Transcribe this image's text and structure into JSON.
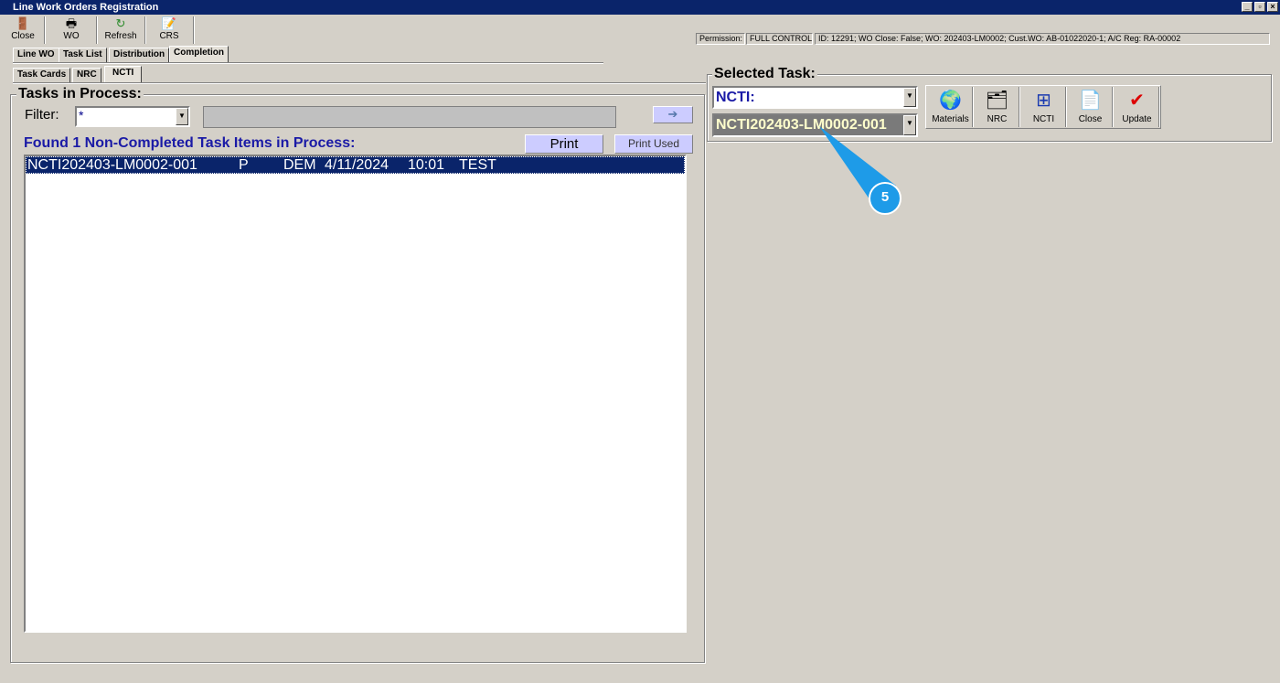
{
  "window": {
    "title": "Line Work Orders Registration"
  },
  "toolbar": {
    "items": [
      {
        "label": "Close",
        "icon": "exit-door-icon"
      },
      {
        "label": "WO",
        "icon": "printer-icon"
      },
      {
        "label": "Refresh",
        "icon": "refresh-icon"
      },
      {
        "label": "CRS",
        "icon": "certificate-icon"
      }
    ]
  },
  "status": {
    "permission_label": "Permission:",
    "permission_value": "FULL CONTROL",
    "info": "ID: 12291; WO Close: False; WO: 202403-LM0002; Cust.WO: AB-01022020-1; A/C Reg: RA-00002"
  },
  "tabs": [
    "Line WO",
    "Task List",
    "Distribution",
    "Completion"
  ],
  "subtabs": [
    "Task Cards",
    "NRC",
    "NCTI"
  ],
  "tasks": {
    "title": "Tasks in Process:",
    "filter_label": "Filter:",
    "filter_value": "*",
    "found_text": "Found 1 Non-Completed Task Items in Process:",
    "print_label": "Print",
    "print_used_label": "Print Used",
    "go_icon": "arrow-right-icon",
    "rows": [
      {
        "id": "NCTI202403-LM0002-001",
        "status": "P",
        "user": "DEM",
        "date": "4/11/2024",
        "time": "10:01",
        "note": "TEST"
      }
    ]
  },
  "selected": {
    "title": "Selected Task:",
    "type_value": "NCTI:",
    "task_value": "NCTI202403-LM0002-001",
    "buttons": [
      {
        "label": "Materials",
        "icon": "materials-globe-icon"
      },
      {
        "label": "NRC",
        "icon": "folder-docs-icon"
      },
      {
        "label": "NCTI",
        "icon": "ncti-window-icon"
      },
      {
        "label": "Close",
        "icon": "close-doc-icon"
      },
      {
        "label": "Update",
        "icon": "clipboard-check-icon"
      }
    ]
  },
  "callout": {
    "number": "5",
    "color": "#1e9be8"
  }
}
